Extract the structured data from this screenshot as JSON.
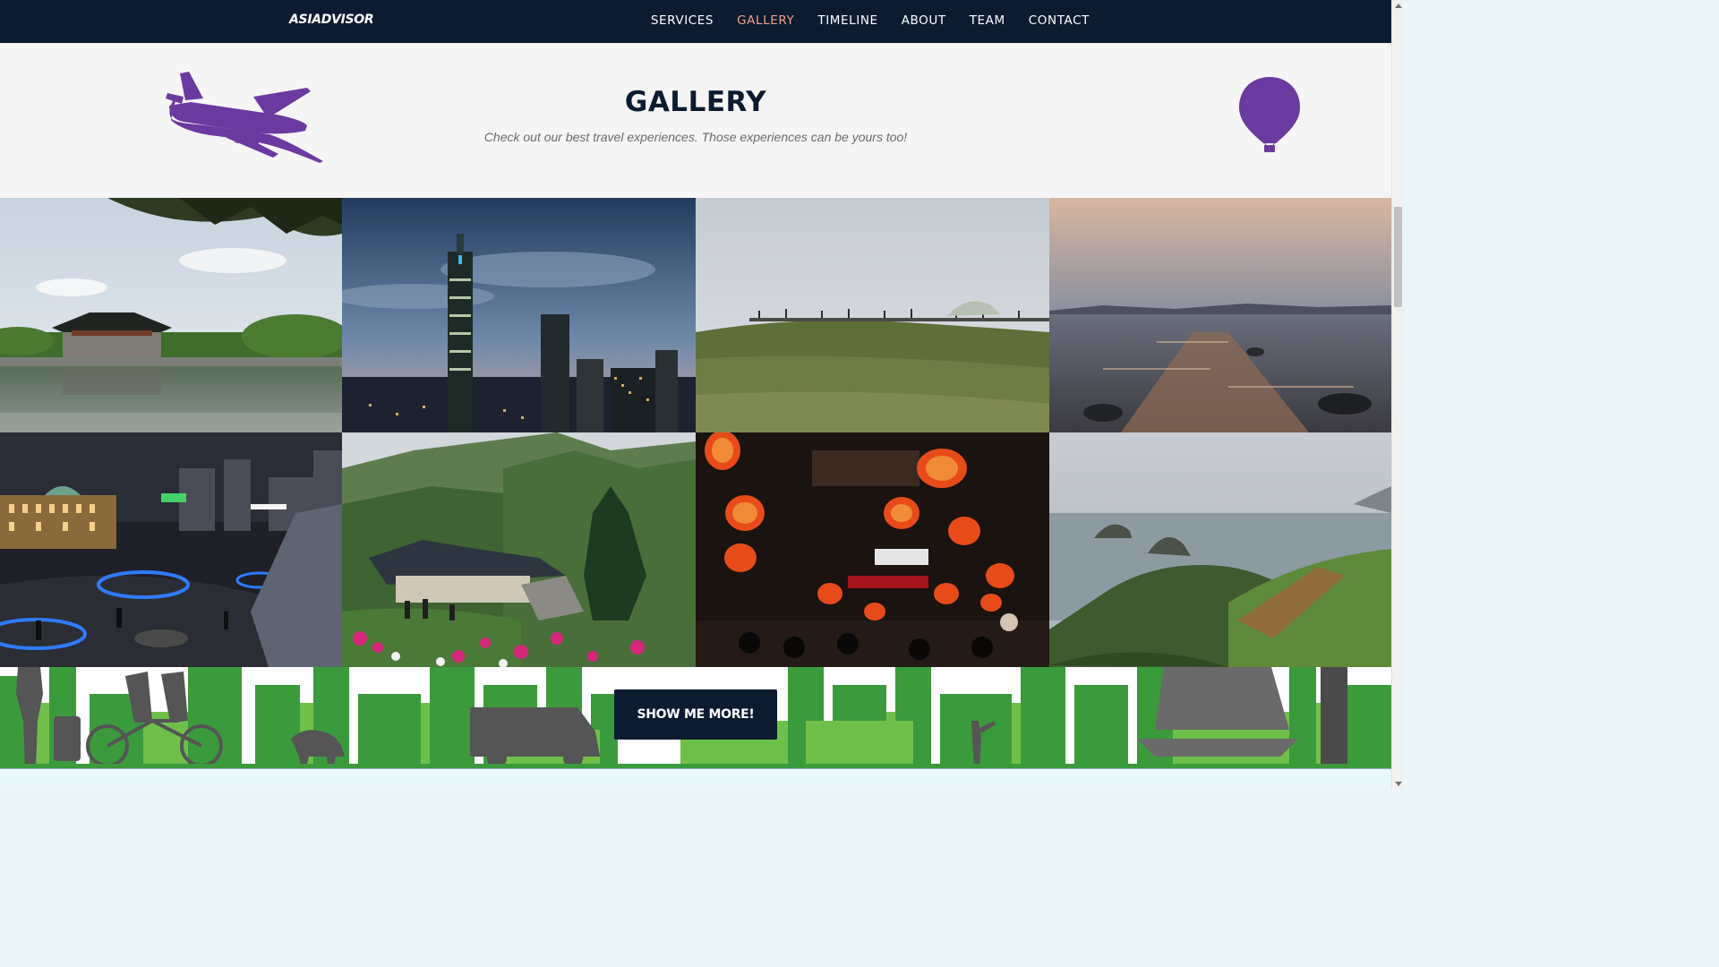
{
  "navbar": {
    "brand": "ASIADVISOR",
    "items": [
      {
        "label": "SERVICES",
        "active": false
      },
      {
        "label": "GALLERY",
        "active": true
      },
      {
        "label": "TIMELINE",
        "active": false
      },
      {
        "label": "ABOUT",
        "active": false
      },
      {
        "label": "TEAM",
        "active": false
      },
      {
        "label": "CONTACT",
        "active": false
      }
    ]
  },
  "gallery": {
    "title": "GALLERY",
    "subtitle": "Check out our best travel experiences. Those experiences can be yours too!",
    "icons": [
      "airplane-icon",
      "hot-air-balloon-icon"
    ],
    "photos": [
      {
        "scene": "palace-pavilion-by-lake"
      },
      {
        "scene": "night-city-skyline-tower"
      },
      {
        "scene": "grassy-hill-boardwalk"
      },
      {
        "scene": "sunset-sea-rocky-path"
      },
      {
        "scene": "night-plaza-illuminated-station"
      },
      {
        "scene": "mountain-temple-flowers"
      },
      {
        "scene": "red-lanterns-night-street"
      },
      {
        "scene": "coastal-cliffs-islets"
      }
    ]
  },
  "cta": {
    "label": "SHOW ME MORE!"
  },
  "colors": {
    "navbar": "#0c1b30",
    "active_nav": "#f0a08e",
    "icon_purple": "#6b3aa0",
    "band_green": "#3a9a3c",
    "band_light_green": "#6fc04a",
    "silhouette_gray": "#555555"
  }
}
